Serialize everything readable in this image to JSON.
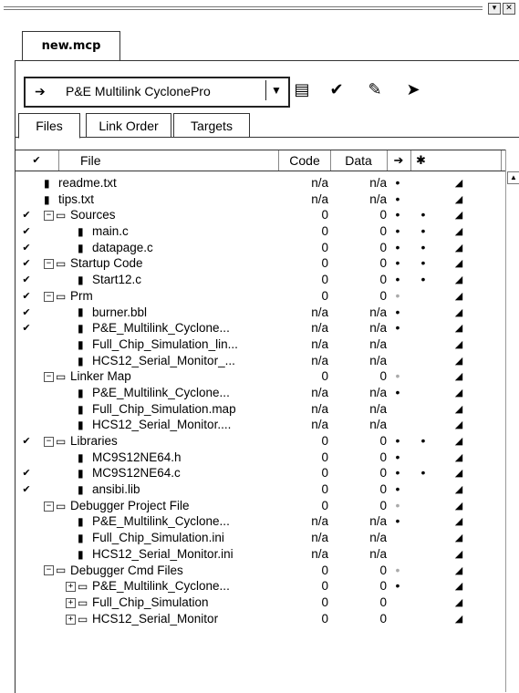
{
  "window": {
    "tab_title": "new.mcp"
  },
  "toolbar": {
    "target": "P&E Multilink CyclonePro",
    "icons": [
      "settings-icon",
      "check-icon",
      "make-icon",
      "debug-icon"
    ]
  },
  "subtabs": [
    "Files",
    "Link Order",
    "Targets"
  ],
  "columns": {
    "file": "File",
    "code": "Code",
    "data": "Data"
  },
  "rows": [
    {
      "indent": 0,
      "type": "file",
      "name": "readme.txt",
      "check": false,
      "code": "n/a",
      "data": "n/a",
      "dot1": "•",
      "dot2": "",
      "expander": ""
    },
    {
      "indent": 0,
      "type": "file",
      "name": "tips.txt",
      "check": false,
      "code": "n/a",
      "data": "n/a",
      "dot1": "•",
      "dot2": "",
      "expander": ""
    },
    {
      "indent": 0,
      "type": "group",
      "name": "Sources",
      "check": true,
      "code": "0",
      "data": "0",
      "dot1": "•",
      "dot2": "•",
      "expander": "-"
    },
    {
      "indent": 1,
      "type": "file",
      "name": "main.c",
      "check": true,
      "code": "0",
      "data": "0",
      "dot1": "•",
      "dot2": "•",
      "expander": ""
    },
    {
      "indent": 1,
      "type": "file",
      "name": "datapage.c",
      "check": true,
      "code": "0",
      "data": "0",
      "dot1": "•",
      "dot2": "•",
      "expander": ""
    },
    {
      "indent": 0,
      "type": "group",
      "name": "Startup Code",
      "check": true,
      "code": "0",
      "data": "0",
      "dot1": "•",
      "dot2": "•",
      "expander": "-"
    },
    {
      "indent": 1,
      "type": "file",
      "name": "Start12.c",
      "check": true,
      "code": "0",
      "data": "0",
      "dot1": "•",
      "dot2": "•",
      "expander": ""
    },
    {
      "indent": 0,
      "type": "group",
      "name": "Prm",
      "check": true,
      "code": "0",
      "data": "0",
      "dot1": "gray",
      "dot2": "",
      "expander": "-"
    },
    {
      "indent": 1,
      "type": "file",
      "name": "burner.bbl",
      "check": true,
      "code": "n/a",
      "data": "n/a",
      "dot1": "•",
      "dot2": "",
      "expander": ""
    },
    {
      "indent": 1,
      "type": "file",
      "name": "P&E_Multilink_Cyclone...",
      "check": true,
      "code": "n/a",
      "data": "n/a",
      "dot1": "•",
      "dot2": "",
      "expander": ""
    },
    {
      "indent": 1,
      "type": "file",
      "name": "Full_Chip_Simulation_lin...",
      "check": false,
      "code": "n/a",
      "data": "n/a",
      "dot1": "",
      "dot2": "",
      "expander": ""
    },
    {
      "indent": 1,
      "type": "file",
      "name": "HCS12_Serial_Monitor_...",
      "check": false,
      "code": "n/a",
      "data": "n/a",
      "dot1": "",
      "dot2": "",
      "expander": ""
    },
    {
      "indent": 0,
      "type": "group",
      "name": "Linker Map",
      "check": false,
      "code": "0",
      "data": "0",
      "dot1": "gray",
      "dot2": "",
      "expander": "-"
    },
    {
      "indent": 1,
      "type": "file",
      "name": "P&E_Multilink_Cyclone...",
      "check": false,
      "code": "n/a",
      "data": "n/a",
      "dot1": "•",
      "dot2": "",
      "expander": ""
    },
    {
      "indent": 1,
      "type": "file",
      "name": "Full_Chip_Simulation.map",
      "check": false,
      "code": "n/a",
      "data": "n/a",
      "dot1": "",
      "dot2": "",
      "expander": ""
    },
    {
      "indent": 1,
      "type": "file",
      "name": "HCS12_Serial_Monitor....",
      "check": false,
      "code": "n/a",
      "data": "n/a",
      "dot1": "",
      "dot2": "",
      "expander": ""
    },
    {
      "indent": 0,
      "type": "group",
      "name": "Libraries",
      "check": true,
      "code": "0",
      "data": "0",
      "dot1": "•",
      "dot2": "•",
      "expander": "-"
    },
    {
      "indent": 1,
      "type": "file",
      "name": "MC9S12NE64.h",
      "check": false,
      "code": "0",
      "data": "0",
      "dot1": "•",
      "dot2": "",
      "expander": ""
    },
    {
      "indent": 1,
      "type": "file",
      "name": "MC9S12NE64.c",
      "check": true,
      "code": "0",
      "data": "0",
      "dot1": "•",
      "dot2": "•",
      "expander": ""
    },
    {
      "indent": 1,
      "type": "file",
      "name": "ansibi.lib",
      "check": true,
      "code": "0",
      "data": "0",
      "dot1": "•",
      "dot2": "",
      "expander": ""
    },
    {
      "indent": 0,
      "type": "group",
      "name": "Debugger Project File",
      "check": false,
      "code": "0",
      "data": "0",
      "dot1": "gray",
      "dot2": "",
      "expander": "-"
    },
    {
      "indent": 1,
      "type": "file",
      "name": "P&E_Multilink_Cyclone...",
      "check": false,
      "code": "n/a",
      "data": "n/a",
      "dot1": "•",
      "dot2": "",
      "expander": ""
    },
    {
      "indent": 1,
      "type": "file",
      "name": "Full_Chip_Simulation.ini",
      "check": false,
      "code": "n/a",
      "data": "n/a",
      "dot1": "",
      "dot2": "",
      "expander": ""
    },
    {
      "indent": 1,
      "type": "file",
      "name": "HCS12_Serial_Monitor.ini",
      "check": false,
      "code": "n/a",
      "data": "n/a",
      "dot1": "",
      "dot2": "",
      "expander": ""
    },
    {
      "indent": 0,
      "type": "group",
      "name": "Debugger Cmd Files",
      "check": false,
      "code": "0",
      "data": "0",
      "dot1": "gray",
      "dot2": "",
      "expander": "-"
    },
    {
      "indent": 1,
      "type": "folder",
      "name": "P&E_Multilink_Cyclone...",
      "check": false,
      "code": "0",
      "data": "0",
      "dot1": "•",
      "dot2": "",
      "expander": "+"
    },
    {
      "indent": 1,
      "type": "folder",
      "name": "Full_Chip_Simulation",
      "check": false,
      "code": "0",
      "data": "0",
      "dot1": "",
      "dot2": "",
      "expander": "+"
    },
    {
      "indent": 1,
      "type": "folder",
      "name": "HCS12_Serial_Monitor",
      "check": false,
      "code": "0",
      "data": "0",
      "dot1": "",
      "dot2": "",
      "expander": "+"
    }
  ]
}
